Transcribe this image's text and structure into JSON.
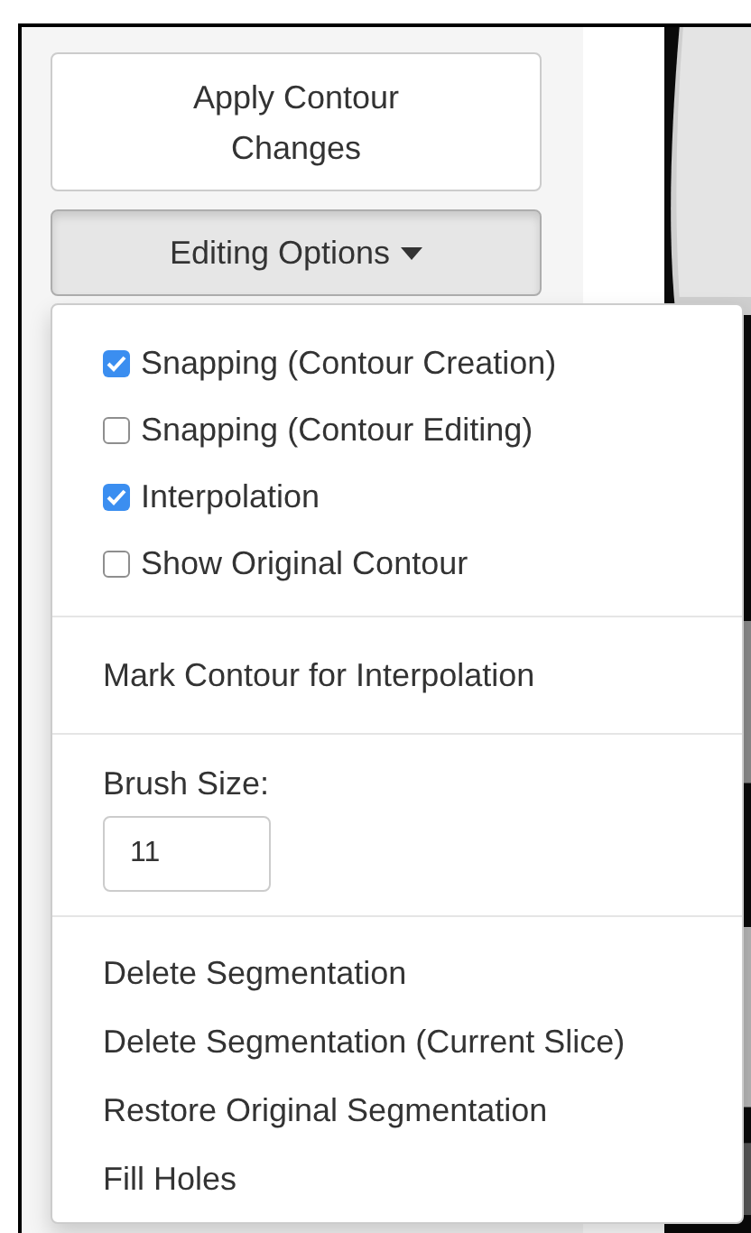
{
  "apply_button": {
    "label": "Apply Contour Changes"
  },
  "editing_options": {
    "label": "Editing Options",
    "expanded": true
  },
  "menu": {
    "checkboxes": [
      {
        "label": "Snapping (Contour Creation)",
        "checked": true
      },
      {
        "label": "Snapping (Contour Editing)",
        "checked": false
      },
      {
        "label": "Interpolation",
        "checked": true
      },
      {
        "label": "Show Original Contour",
        "checked": false
      }
    ],
    "mark_item": "Mark Contour for Interpolation",
    "brush_size": {
      "label": "Brush Size:",
      "value": "11"
    },
    "actions": [
      "Delete Segmentation",
      "Delete Segmentation (Current Slice)",
      "Restore Original Segmentation",
      "Fill Holes"
    ]
  }
}
